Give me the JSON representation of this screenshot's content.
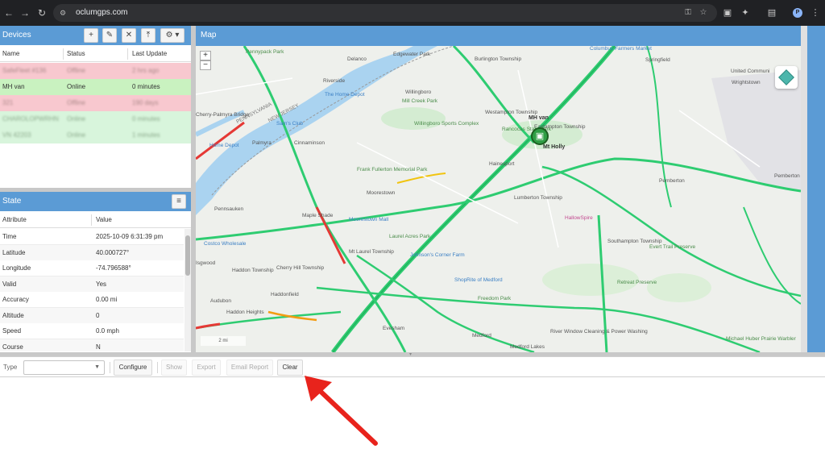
{
  "browser": {
    "url": "oclumgps.com",
    "icons": [
      "back-icon",
      "forward-icon",
      "reload-icon",
      "site-settings-icon",
      "password-key-icon",
      "bookmark-star-icon",
      "cast-icon",
      "extensions-icon",
      "sidepanel-icon",
      "profile-icon",
      "menu-dots-icon"
    ],
    "profile_initial": "P"
  },
  "devices": {
    "title": "Devices",
    "tools": [
      "add-icon",
      "edit-icon",
      "remove-icon",
      "upload-icon",
      "settings-gear-icon"
    ],
    "columns": [
      "Name",
      "Status",
      "Last Update"
    ],
    "rows": [
      {
        "name": "SafeFleet #136",
        "status": "Offline",
        "last_update": "2 hrs ago",
        "color": "#f8c8cf",
        "obscured": true
      },
      {
        "name": "MH van",
        "status": "Online",
        "last_update": "0 minutes",
        "color": "#c9f2c0",
        "obscured": false
      },
      {
        "name": "321",
        "status": "Offline",
        "last_update": "190 days",
        "color": "#f8c8cf",
        "obscured": true
      },
      {
        "name": "CHAROLOPWRHN",
        "status": "Online",
        "last_update": "0 minutes",
        "color": "#d8f5dc",
        "obscured": true
      },
      {
        "name": "VN 42203",
        "status": "Online",
        "last_update": "1 minutes",
        "color": "#d8f5dc",
        "obscured": true
      }
    ]
  },
  "state": {
    "title": "State",
    "columns": [
      "Attribute",
      "Value"
    ],
    "rows": [
      {
        "attribute": "Time",
        "value": "2025-10-09 6:31:39 pm"
      },
      {
        "attribute": "Latitude",
        "value": "40.000727°"
      },
      {
        "attribute": "Longitude",
        "value": "-74.796588°"
      },
      {
        "attribute": "Valid",
        "value": "Yes"
      },
      {
        "attribute": "Accuracy",
        "value": "0.00 mi"
      },
      {
        "attribute": "Altitude",
        "value": "0"
      },
      {
        "attribute": "Speed",
        "value": "0.0 mph"
      },
      {
        "attribute": "Course",
        "value": "N"
      }
    ]
  },
  "map": {
    "title": "Map",
    "zoom_in": "+",
    "zoom_out": "−",
    "scale": "2 mi",
    "vehicle_label": "MH van",
    "labels": [
      {
        "text": "Pennypack Park",
        "kind": "green"
      },
      {
        "text": "Delanco",
        "kind": "plain"
      },
      {
        "text": "Edgewater Park",
        "kind": "plain"
      },
      {
        "text": "Burlington Township",
        "kind": "plain"
      },
      {
        "text": "Columbus Farmers Market",
        "kind": "poi"
      },
      {
        "text": "United Communi",
        "kind": "plain"
      },
      {
        "text": "Wrightstown",
        "kind": "plain"
      },
      {
        "text": "Springfield",
        "kind": "plain"
      },
      {
        "text": "Riverside",
        "kind": "plain"
      },
      {
        "text": "The Home Depot",
        "kind": "poi"
      },
      {
        "text": "Willingboro",
        "kind": "plain"
      },
      {
        "text": "Mill Creek Park",
        "kind": "green"
      },
      {
        "text": "Westampton Township",
        "kind": "plain"
      },
      {
        "text": "Eastampton Township",
        "kind": "plain"
      },
      {
        "text": "Rancocas State Park",
        "kind": "green"
      },
      {
        "text": "Mt Holly",
        "kind": "bold"
      },
      {
        "text": "Sam's Club",
        "kind": "poi"
      },
      {
        "text": "Willingboro Sports Complex",
        "kind": "green"
      },
      {
        "text": "Palmyra",
        "kind": "plain"
      },
      {
        "text": "Cinnaminson",
        "kind": "plain"
      },
      {
        "text": "Home Depot",
        "kind": "poi"
      },
      {
        "text": "Hainesport",
        "kind": "plain"
      },
      {
        "text": "Frank Fullerton Memorial Park",
        "kind": "green"
      },
      {
        "text": "Moorestown",
        "kind": "plain"
      },
      {
        "text": "Lumberton Township",
        "kind": "plain"
      },
      {
        "text": "Pemberton",
        "kind": "plain"
      },
      {
        "text": "Pemberton Township",
        "kind": "plain"
      },
      {
        "text": "Pennsauken",
        "kind": "plain"
      },
      {
        "text": "Maple Shade",
        "kind": "plain"
      },
      {
        "text": "Moorestown Mall",
        "kind": "poi"
      },
      {
        "text": "HallowSpire",
        "kind": "pink"
      },
      {
        "text": "Costco Wholesale",
        "kind": "poi"
      },
      {
        "text": "Laurel Acres Park",
        "kind": "green"
      },
      {
        "text": "Southampton Township",
        "kind": "plain"
      },
      {
        "text": "Evert Trail Preserve",
        "kind": "green"
      },
      {
        "text": "Mt Laurel Township",
        "kind": "plain"
      },
      {
        "text": "Johnson's Corner Farm",
        "kind": "poi"
      },
      {
        "text": "Cherry Hill Township",
        "kind": "plain"
      },
      {
        "text": "Haddon Township",
        "kind": "plain"
      },
      {
        "text": "ShopRite of Medford",
        "kind": "poi"
      },
      {
        "text": "Haddonfield",
        "kind": "plain"
      },
      {
        "text": "Retreat Preserve",
        "kind": "green"
      },
      {
        "text": "Audubon",
        "kind": "plain"
      },
      {
        "text": "Freedom Park",
        "kind": "green"
      },
      {
        "text": "Haddon Heights",
        "kind": "plain"
      },
      {
        "text": "Evesham",
        "kind": "plain"
      },
      {
        "text": "Medford",
        "kind": "plain"
      },
      {
        "text": "River Window Cleaning & Power Washing",
        "kind": "plain"
      },
      {
        "text": "Medford Lakes",
        "kind": "plain"
      },
      {
        "text": "Michael Huber Prairie Warbler",
        "kind": "green"
      },
      {
        "text": "PENNSYLVANIA",
        "kind": "plain"
      },
      {
        "text": "NEW JERSEY",
        "kind": "plain"
      },
      {
        "text": "Cherry-Palmyra Bridge",
        "kind": "plain"
      },
      {
        "text": "Isgwood",
        "kind": "plain"
      }
    ]
  },
  "reports": {
    "type_label": "Type",
    "type_value": "",
    "buttons": {
      "configure": "Configure",
      "show": "Show",
      "export": "Export",
      "email": "Email Report",
      "clear": "Clear"
    }
  },
  "colors": {
    "header_blue": "#5b9bd5",
    "online_green": "#c9f2c0",
    "offline_red": "#f8c8cf",
    "annotation_red": "#e8231c"
  }
}
